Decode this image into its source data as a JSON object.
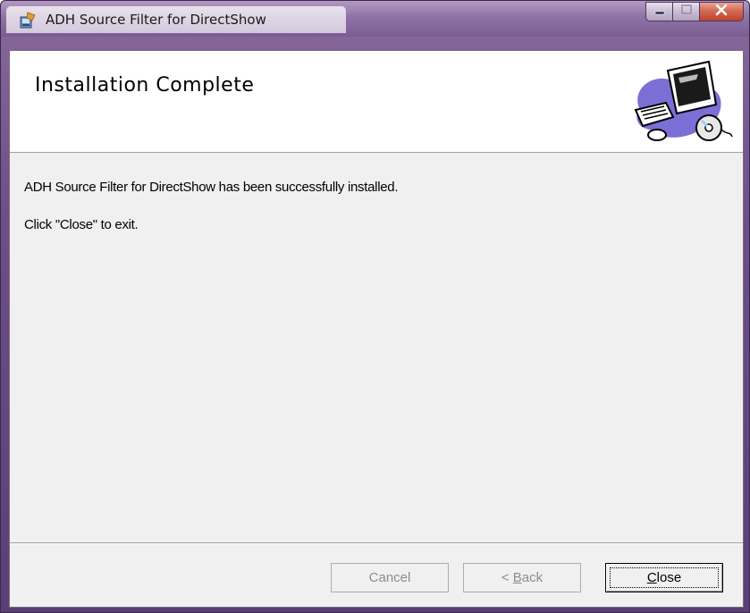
{
  "window": {
    "title": "ADH Source Filter for DirectShow",
    "icon": "installer-icon",
    "caption_buttons": [
      "minimize-icon",
      "maximize-icon",
      "close-icon"
    ]
  },
  "header": {
    "title": "Installation Complete",
    "banner_icon": "computer-with-cd-icon"
  },
  "body": {
    "message": "ADH Source Filter for DirectShow has been successfully installed.",
    "instruction": "Click \"Close\" to exit."
  },
  "buttons": {
    "cancel": {
      "label": "Cancel",
      "enabled": false
    },
    "back": {
      "label": "< Back",
      "prefix": "< ",
      "mnemonic": "B",
      "rest": "ack",
      "enabled": false
    },
    "close": {
      "label": "Close",
      "mnemonic": "C",
      "rest": "lose",
      "enabled": true,
      "default": true
    }
  },
  "colors": {
    "frame": "#7b5d95",
    "close_button": "#c2432b",
    "client_background": "#f0f0f0"
  }
}
